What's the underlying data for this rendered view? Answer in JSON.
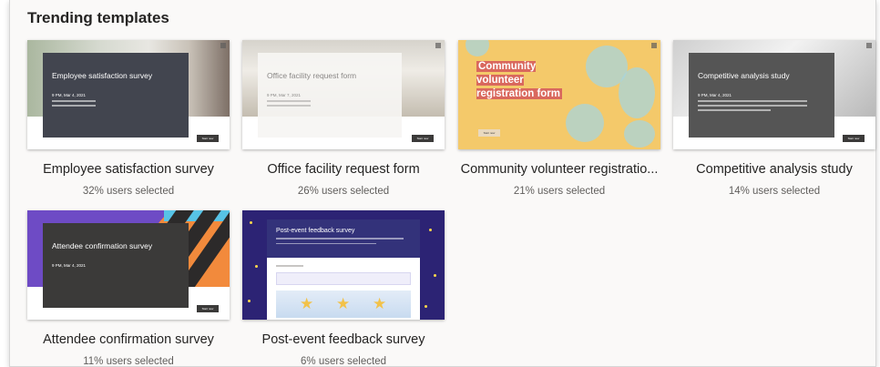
{
  "heading": "Trending templates",
  "button_label": "Start now",
  "cards": [
    {
      "title": "Employee satisfaction survey",
      "stat": "32% users selected",
      "thumb_title": "Employee satisfaction survey",
      "thumb_date": "9 PM, Mar 4, 2021"
    },
    {
      "title": "Office facility request form",
      "stat": "26% users selected",
      "thumb_title": "Office facility request form",
      "thumb_date": "9 PM, Mar 7, 2021"
    },
    {
      "title": "Community volunteer registratio...",
      "stat": "21% users selected",
      "thumb_title": "Community volunteer registration form"
    },
    {
      "title": "Competitive analysis study",
      "stat": "14% users selected",
      "thumb_title": "Competitive analysis study",
      "thumb_date": "9 PM, Mar 4, 2021"
    },
    {
      "title": "Attendee confirmation survey",
      "stat": "11% users selected",
      "thumb_title": "Attendee confirmation survey",
      "thumb_date": "9 PM, Mar 4, 2021"
    },
    {
      "title": "Post-event feedback survey",
      "stat": "6% users selected",
      "thumb_title": "Post-event feedback survey"
    }
  ],
  "colors": {
    "panel_bg": "#faf9f8",
    "title_text": "#252423",
    "stat_text": "#605e5c",
    "dark_overlay": "#42454f",
    "yellow_theme": "#f4c96a",
    "purple_theme": "#6e4bc5",
    "navy_theme": "#2c2374",
    "orange_accent": "#f28a3c"
  }
}
